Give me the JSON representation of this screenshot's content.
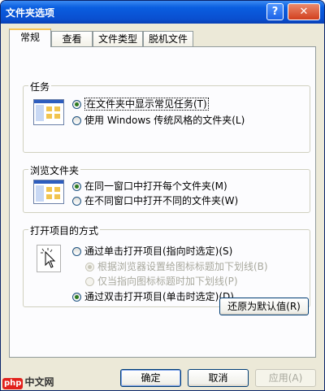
{
  "window": {
    "title": "文件夹选项",
    "help_label": "?",
    "close_label": "✕"
  },
  "tabs": [
    {
      "label": "常规",
      "active": true
    },
    {
      "label": "查看",
      "active": false
    },
    {
      "label": "文件类型",
      "active": false
    },
    {
      "label": "脱机文件",
      "active": false
    }
  ],
  "tasks": {
    "label": "任务",
    "option1": "在文件夹中显示常见任务(T)",
    "option2": "使用 Windows 传统风格的文件夹(L)",
    "selected": 0
  },
  "browse": {
    "label": "浏览文件夹",
    "option1": "在同一窗口中打开每个文件夹(M)",
    "option2": "在不同窗口中打开不同的文件夹(W)",
    "selected": 0
  },
  "open_items": {
    "label": "打开项目的方式",
    "option1": "通过单击打开项目(指向时选定)(S)",
    "sub1": "根据浏览器设置给图标标题加下划线(B)",
    "sub2": "仅当指向图标标题时加下划线(P)",
    "option2": "通过双击打开项目(单击时选定)(D)",
    "selected": 1
  },
  "buttons": {
    "restore": "还原为默认值(R)",
    "ok": "确定",
    "cancel": "取消",
    "apply": "应用(A)"
  },
  "watermark": {
    "logo": "php",
    "text": "中文网"
  }
}
